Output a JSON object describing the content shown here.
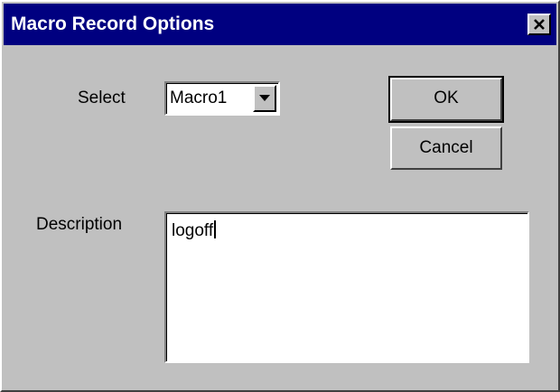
{
  "window": {
    "title": "Macro Record Options"
  },
  "form": {
    "select_label": "Select",
    "select_value": "Macro1",
    "description_label": "Description",
    "description_value": "logoff"
  },
  "buttons": {
    "ok_label": "OK",
    "cancel_label": "Cancel"
  },
  "icons": {
    "close": "close-icon",
    "dropdown": "chevron-down-icon"
  },
  "colors": {
    "titlebar": "#000080",
    "face": "#c0c0c0"
  }
}
